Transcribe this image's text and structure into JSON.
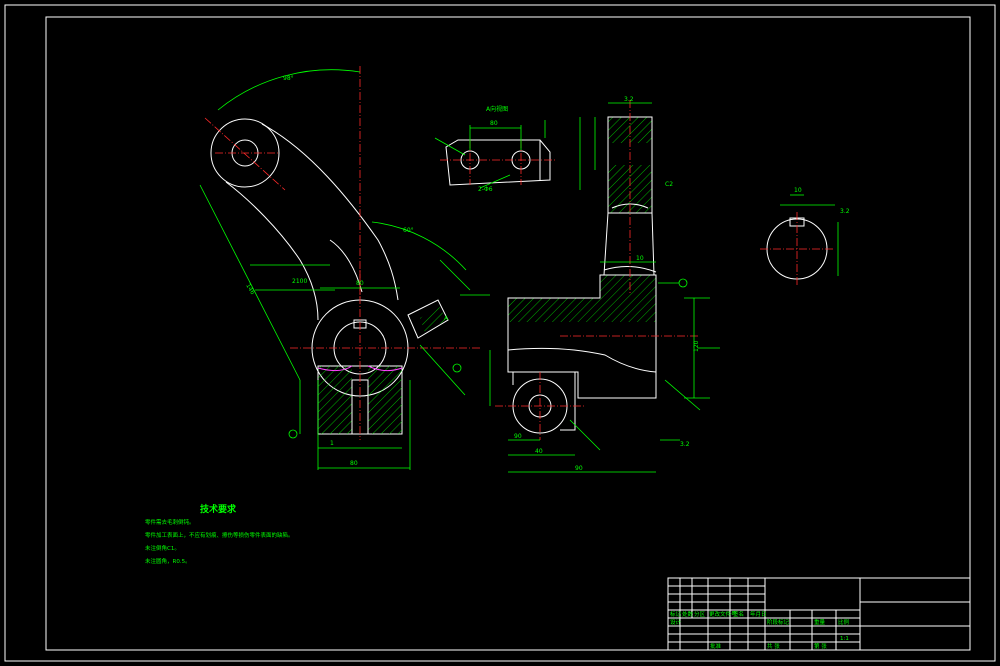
{
  "colors": {
    "background": "#000000",
    "outline": "#ffffff",
    "dimension": "#00ff00",
    "centerline": "#ff2a2a",
    "accent": "#ff44ff"
  },
  "tech_requirements": {
    "title": "技术要求",
    "items": [
      "零件需去毛刺倒钝。",
      "零件加工表面上，不应有划痕、擦伤等损伤零件表面的缺陷。",
      "未注倒角C1。",
      "未注圆角，R0.5。"
    ]
  },
  "views": {
    "top_view_label": "A向视图",
    "section_mark": "A"
  },
  "dimensions": {
    "arc_angle_top": "98°",
    "arc_angle_right": "60°",
    "boss_width": "80",
    "base_width": "80",
    "base_depth": "1",
    "side_len": "146",
    "web_len": "2100",
    "right_base": "90",
    "right_total": "90",
    "right_height": "120",
    "right_sub": "40",
    "right_small": "10",
    "slot_pitch": "80",
    "hole_label": "2-Φ6",
    "surface": "3.2",
    "chamfer": "C2"
  },
  "title_block": {
    "row_labels": [
      "标记",
      "处数",
      "分区",
      "更改文件号",
      "签名",
      "年月日"
    ],
    "design": "设计",
    "stage": "阶段标记",
    "weight": "重量",
    "scale": "比例",
    "scale_value": "1:1",
    "sheets": "共 张",
    "sheet_no": "第 张",
    "approve": "批准"
  }
}
